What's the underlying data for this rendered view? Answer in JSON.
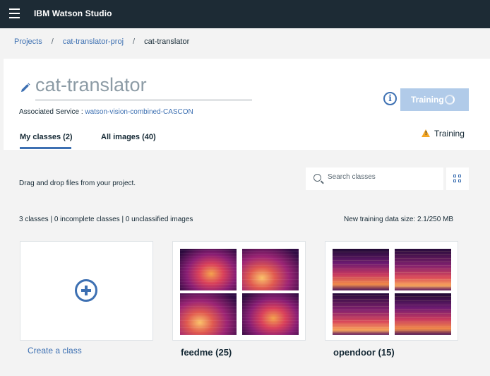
{
  "app": {
    "title": "IBM Watson Studio"
  },
  "breadcrumb": {
    "items": [
      "Projects",
      "cat-translator-proj",
      "cat-translator"
    ],
    "separator": "/"
  },
  "model": {
    "name": "cat-translator",
    "assoc_label": "Associated Service : ",
    "assoc_service": "watson-vision-combined-CASCON"
  },
  "actions": {
    "train_label": "Training",
    "status_label": "Training"
  },
  "tabs": [
    {
      "label": "My classes (2)",
      "active": true
    },
    {
      "label": "All images (40)",
      "active": false
    }
  ],
  "toolbar": {
    "drag_hint": "Drag and drop files from your project.",
    "search_placeholder": "Search classes"
  },
  "summary": {
    "stats": "3 classes | 0 incomplete classes | 0 unclassified images",
    "size": "New training data size: 2.1/250 MB"
  },
  "create": {
    "label": "Create a class"
  },
  "classes": [
    {
      "name": "feedme (25)"
    },
    {
      "name": "opendoor (15)"
    }
  ],
  "colors": {
    "accent": "#3d70b2",
    "topbar": "#1d2b35",
    "button_disabled": "#b1cbe9",
    "warning": "#f5a623"
  },
  "icons": [
    "menu-icon",
    "pencil-icon",
    "info-icon",
    "spinner-icon",
    "warning-icon",
    "search-icon",
    "grid-view-icon",
    "add-icon"
  ]
}
